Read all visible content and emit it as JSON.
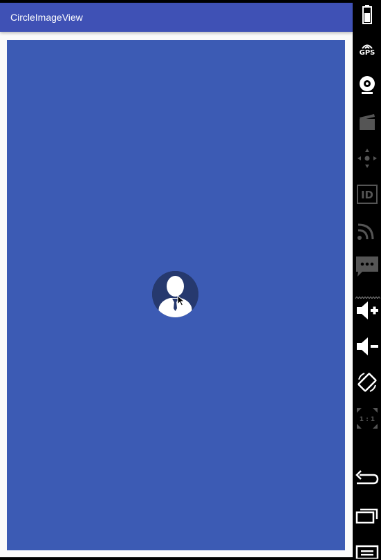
{
  "app": {
    "title": "CircleImageView"
  },
  "colors": {
    "toolbar": "#3f51b5",
    "content_background": "#3c5bb4",
    "avatar_background": "#26396e",
    "emulator_sidebar": "#000000"
  },
  "emulator_controls": {
    "gps_label": "GPS",
    "id_label": "ID",
    "zoom_label": "1 : 1",
    "items": [
      "battery-icon",
      "gps-icon",
      "webcam-icon",
      "media-icon",
      "dpad-icon",
      "device-id-icon",
      "network-icon",
      "sms-icon",
      "volume-up-icon",
      "volume-down-icon",
      "rotate-icon",
      "scale-icon",
      "back-icon",
      "recent-apps-icon",
      "menu-icon"
    ]
  }
}
